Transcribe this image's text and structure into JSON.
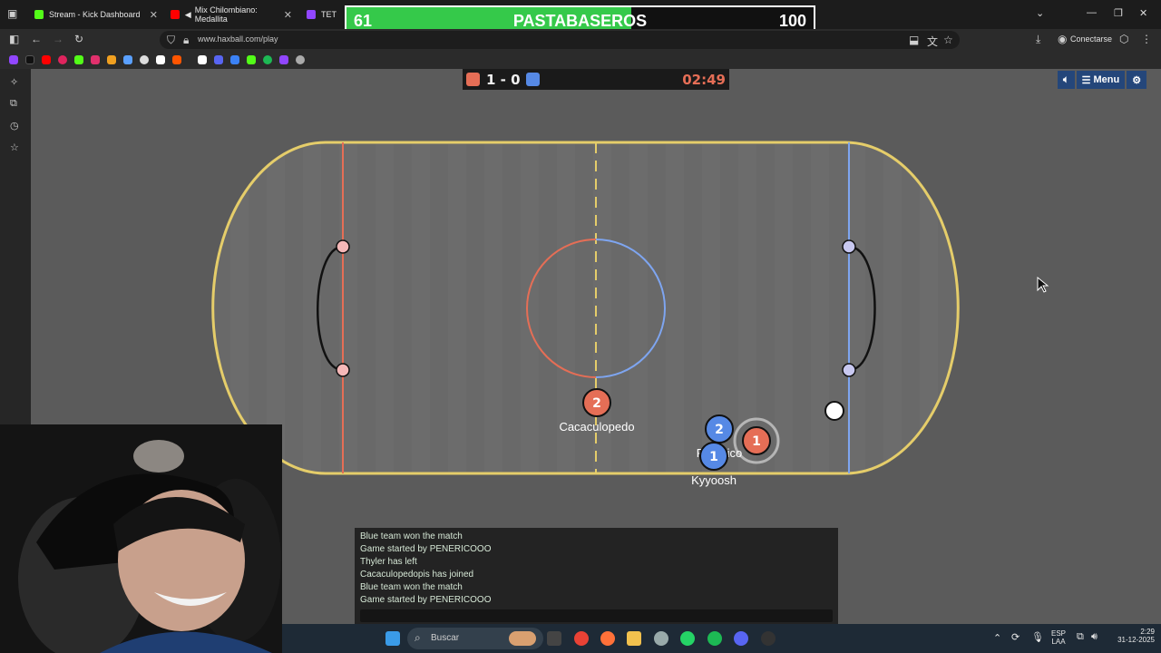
{
  "browser": {
    "tabs": [
      {
        "label": "Stream - Kick Dashboard",
        "color": "#53fc18"
      },
      {
        "label": "Mix Chilombiano: Medallita",
        "color": "#ff0000"
      },
      {
        "label": "TET",
        "color": "#9146ff"
      }
    ],
    "url": "www.haxball.com/play",
    "connect_label": "Conectarse"
  },
  "overlay": {
    "left_value": "61",
    "title": "PASTABASEROS",
    "right_value": "100",
    "progress": 0.61
  },
  "scoreboard": {
    "score": "1 - 0",
    "timer": "02:49",
    "red_color": "#e56e56",
    "blue_color": "#5689e5"
  },
  "controls": {
    "sound_icon": "speaker-icon",
    "menu_label": "Menu",
    "settings_icon": "gear-icon"
  },
  "players": [
    {
      "number": "2",
      "team": "red",
      "name": "Cacaculopedo"
    },
    {
      "number": "2",
      "team": "blue",
      "name": "Perchico"
    },
    {
      "number": "1",
      "team": "blue",
      "name": "Kyyoosh"
    },
    {
      "number": "1",
      "team": "red",
      "name": ""
    }
  ],
  "chat": {
    "lines": [
      "Blue team won the match",
      "Game started by PENERICOOO",
      "Thyler has left",
      "Cacaculopedopis has joined",
      "Blue team won the match",
      "Game started by PENERICOOO"
    ]
  },
  "taskbar": {
    "search_placeholder": "Buscar",
    "lang": "ESP",
    "layout": "LAA",
    "time": "2:29",
    "date": "31-12-2025"
  }
}
